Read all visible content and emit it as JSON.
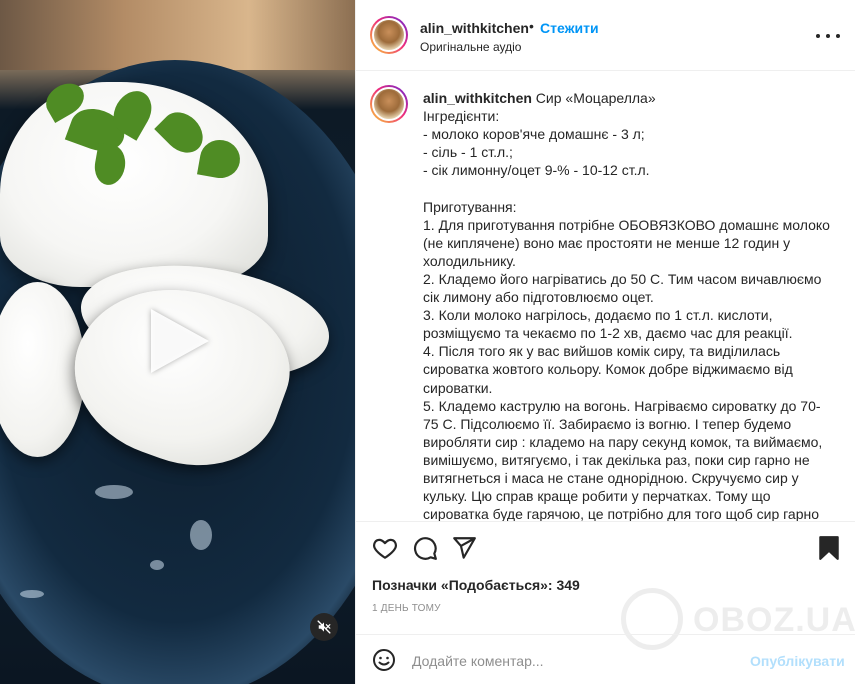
{
  "post": {
    "username": "alin_withkitchen",
    "separator": "•",
    "follow_label": "Стежити",
    "audio_label": "Оригінальне аудіо"
  },
  "caption": {
    "username": "alin_withkitchen",
    "text": " Сир «Моцарелла»\nІнгредієнти:\n- молоко коров'яче домашнє - 3 л;\n- сіль - 1 ст.л.;\n- сік лимонну/оцет 9-% - 10-12 ст.л.\n\nПриготування:\n1. Для приготування потрібне ОБОВЯЗКОВО домашнє молоко (не киплячене) воно має простояти не менше 12 годин у холодильнику.\n2. Кладемо його нагріватись до 50 С. Тим часом вичавлюємо сік лимону або підготовлюємо оцет.\n3. Коли молоко нагрілось, додаємо по 1 ст.л. кислоти, розміщуємо та чекаємо по 1-2 хв, даємо час для реакції.\n4. Після того як у вас вийшов комік сиру, та виділилась сироватка жовтого кольору. Комок добре віджимаємо від сироватки.\n5. Кладемо каструлю на вогонь. Нагріваємо сироватку до 70-75 С. Підсолюємо її. Забираємо із вогню. І тепер будемо виробляти сир : кладемо на пару секунд комок, та виймаємо, вимішуємо, витягуємо, і так декілька раз, поки сир гарно не витягнеться і маса не стане однорідною. Скручуємо сир у кульку. Цю справ краще робити у перчатках. Тому що сироватка буде гарячою, це потрібно для того щоб сир гарно"
  },
  "likes": {
    "text": "Позначки «Подобається»: 349"
  },
  "time_ago": "1 ДЕНЬ ТОМУ",
  "comment": {
    "placeholder": "Додайте коментар...",
    "publish_label": "Опублікувати"
  },
  "watermark": {
    "text": "OBOZ.UA"
  },
  "colors": {
    "accent": "#0095f6",
    "publish_disabled": "#b2dffc",
    "text": "#262626",
    "muted": "#8e8e8e"
  },
  "icons": {
    "like": "heart-icon",
    "comment": "comment-icon",
    "share": "share-icon",
    "save": "bookmark-icon",
    "more": "more-options-icon",
    "mute": "muted-speaker-icon",
    "play": "play-icon",
    "emoji": "emoji-icon"
  }
}
